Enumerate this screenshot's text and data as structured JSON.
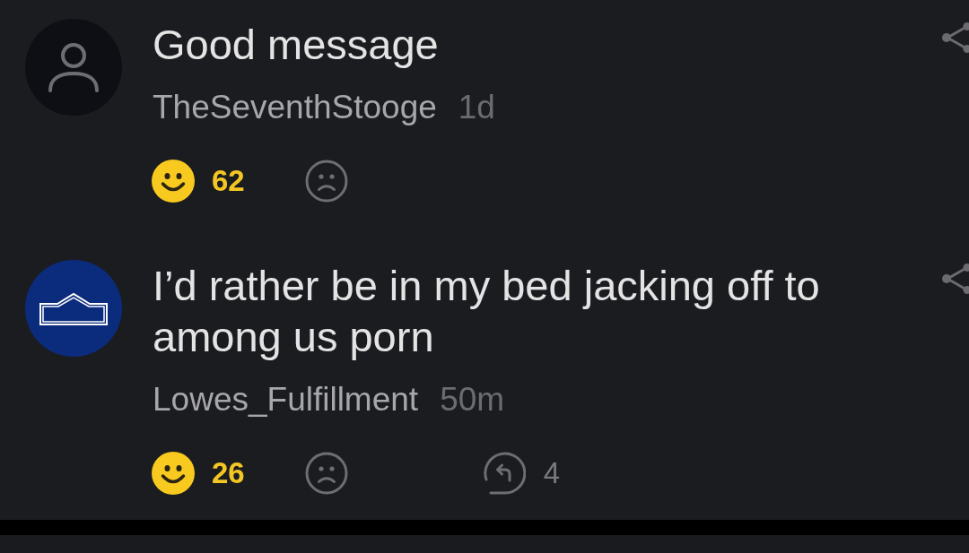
{
  "comments": [
    {
      "avatar": {
        "kind": "silhouette"
      },
      "text": "Good message",
      "author": "TheSeventhStooge",
      "time": "1d",
      "smiles": "62"
    },
    {
      "avatar": {
        "kind": "logo"
      },
      "text": "I’d rather be in my bed jacking off to among us porn",
      "author": "Lowes_Fulfillment",
      "time": "50m",
      "smiles": "26",
      "replies": "4"
    }
  ]
}
